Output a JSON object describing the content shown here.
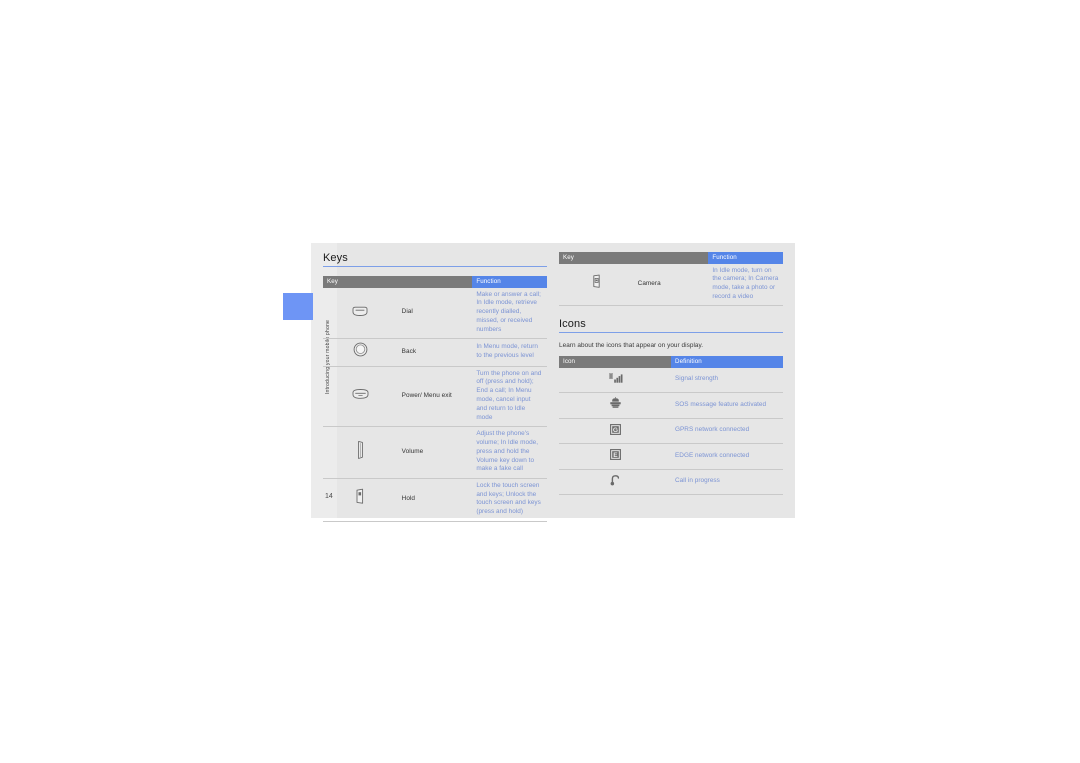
{
  "page": {
    "chapter_label": "Introducing your mobile phone",
    "folio": "14"
  },
  "keys_section": {
    "title": "Keys",
    "table": {
      "headers": {
        "key": "Key",
        "function": "Function"
      },
      "rows": [
        {
          "icon": "dial-key-icon",
          "name": "Dial",
          "description": "Make or answer a call; In Idle mode, retrieve recently dialled, missed, or received numbers"
        },
        {
          "icon": "back-key-icon",
          "name": "Back",
          "description": "In Menu mode, return to the previous level"
        },
        {
          "icon": "power-menu-exit-key-icon",
          "name": "Power/ Menu exit",
          "description": "Turn the phone on and off (press and hold); End a call; In Menu mode, cancel input and return to Idle mode"
        },
        {
          "icon": "volume-key-icon",
          "name": "Volume",
          "description": "Adjust the phone's volume; In Idle mode, press and hold the Volume key down to make a fake call"
        },
        {
          "icon": "hold-key-icon",
          "name": "Hold",
          "description": "Lock the touch screen and keys; Unlock the touch screen and keys (press and hold)"
        }
      ]
    }
  },
  "keys_section_continued": {
    "table": {
      "headers": {
        "key": "Key",
        "function": "Function"
      },
      "rows": [
        {
          "icon": "camera-key-icon",
          "name": "Camera",
          "description": "In Idle mode, turn on the camera; In Camera mode, take a photo or record a video"
        }
      ]
    }
  },
  "icons_section": {
    "title": "Icons",
    "intro": "Learn about the icons that appear on your display.",
    "table": {
      "headers": {
        "icon": "Icon",
        "definition": "Definition"
      },
      "rows": [
        {
          "icon": "signal-strength-icon",
          "definition": "Signal strength"
        },
        {
          "icon": "sos-message-icon",
          "definition": "SOS message feature activated"
        },
        {
          "icon": "gprs-network-icon",
          "definition": "GPRS network connected"
        },
        {
          "icon": "edge-network-icon",
          "definition": "EDGE network connected"
        },
        {
          "icon": "call-in-progress-icon",
          "definition": "Call in progress"
        }
      ]
    }
  },
  "colors": {
    "page_background": "#e6e6e6",
    "accent_blue": "#5585e8",
    "header_gray": "#7a7a7a",
    "body_blue_text": "#7b93d4",
    "chapter_tab_blue": "#6e95f5",
    "rule_blue": "#7d9fe8"
  }
}
